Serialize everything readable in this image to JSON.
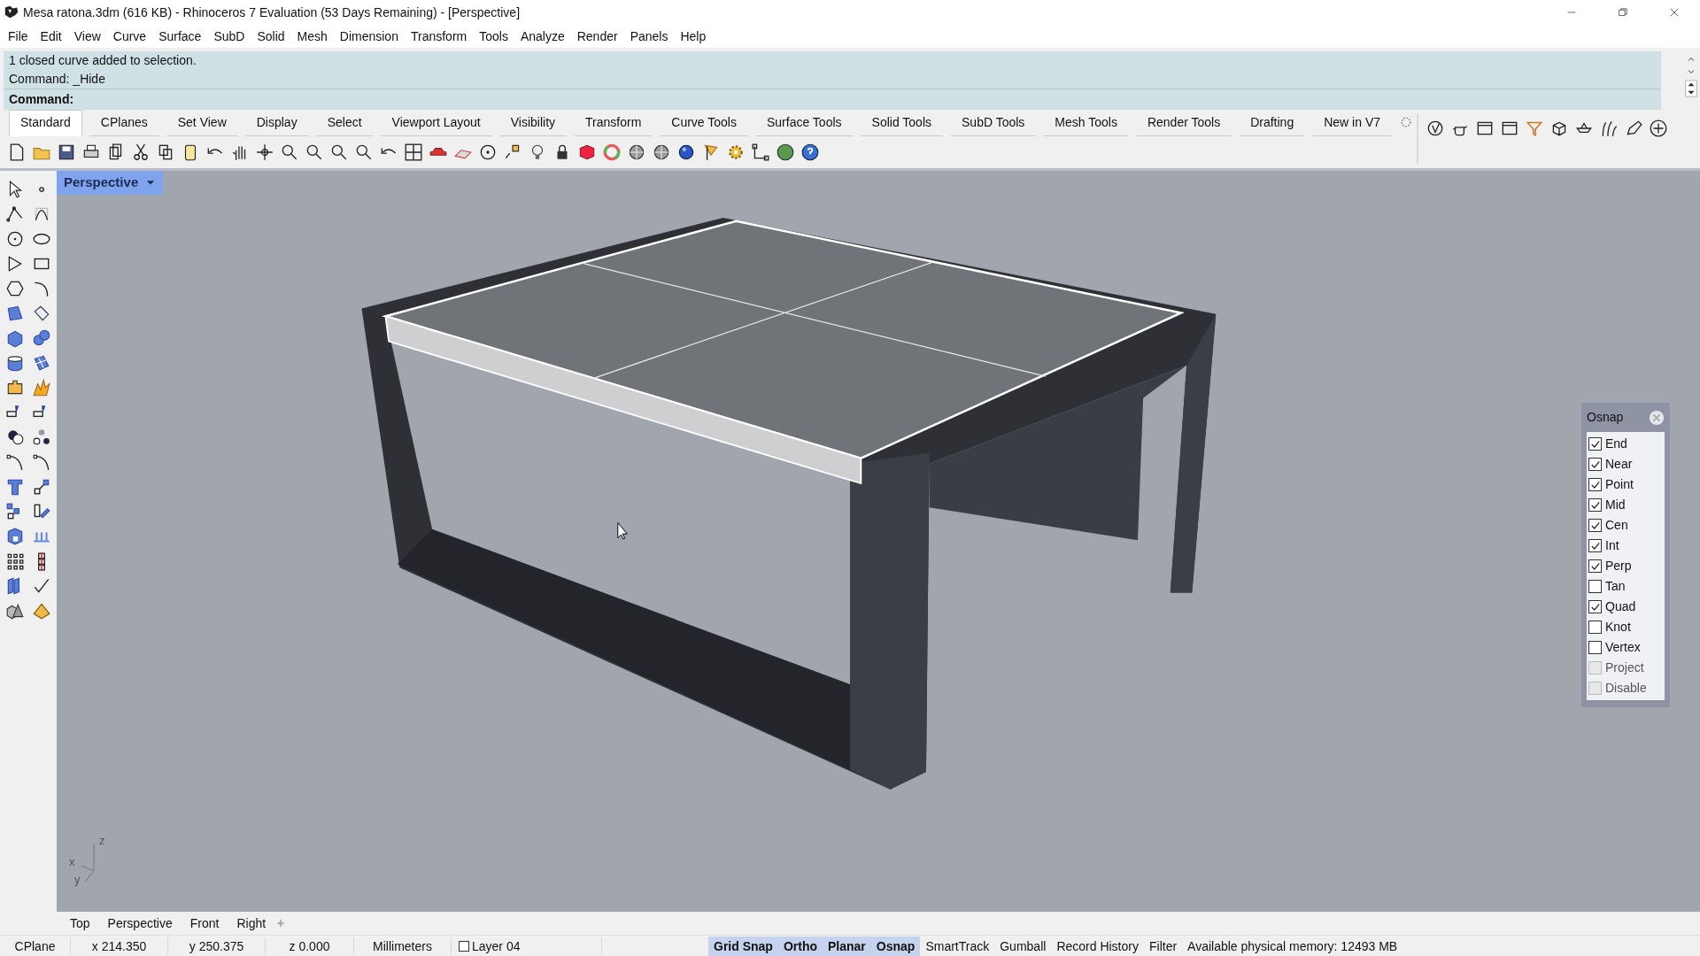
{
  "window": {
    "title": "Mesa ratona.3dm (616 KB) - Rhinoceros 7 Evaluation (53 Days Remaining) - [Perspective]"
  },
  "menu": [
    "File",
    "Edit",
    "View",
    "Curve",
    "Surface",
    "SubD",
    "Solid",
    "Mesh",
    "Dimension",
    "Transform",
    "Tools",
    "Analyze",
    "Render",
    "Panels",
    "Help"
  ],
  "command": {
    "history": [
      "1 closed curve added to selection.",
      "Command: _Hide"
    ],
    "prompt": "Command:"
  },
  "toolbar_tabs": [
    {
      "label": "Standard",
      "selected": true
    },
    {
      "label": "CPlanes",
      "selected": false
    },
    {
      "label": "Set View",
      "selected": false
    },
    {
      "label": "Display",
      "selected": false
    },
    {
      "label": "Select",
      "selected": false
    },
    {
      "label": "Viewport Layout",
      "selected": false
    },
    {
      "label": "Visibility",
      "selected": false
    },
    {
      "label": "Transform",
      "selected": false
    },
    {
      "label": "Curve Tools",
      "selected": false
    },
    {
      "label": "Surface Tools",
      "selected": false
    },
    {
      "label": "Solid Tools",
      "selected": false
    },
    {
      "label": "SubD Tools",
      "selected": false
    },
    {
      "label": "Mesh Tools",
      "selected": false
    },
    {
      "label": "Render Tools",
      "selected": false
    },
    {
      "label": "Drafting",
      "selected": false
    },
    {
      "label": "New in V7",
      "selected": false
    }
  ],
  "viewport": {
    "title": "Perspective",
    "axis_labels": [
      "z",
      "x",
      "y"
    ]
  },
  "osnap": {
    "title": "Osnap",
    "items": [
      {
        "label": "End",
        "checked": true,
        "disabled": false
      },
      {
        "label": "Near",
        "checked": true,
        "disabled": false
      },
      {
        "label": "Point",
        "checked": true,
        "disabled": false
      },
      {
        "label": "Mid",
        "checked": true,
        "disabled": false
      },
      {
        "label": "Cen",
        "checked": true,
        "disabled": false
      },
      {
        "label": "Int",
        "checked": true,
        "disabled": false
      },
      {
        "label": "Perp",
        "checked": true,
        "disabled": false
      },
      {
        "label": "Tan",
        "checked": false,
        "disabled": false
      },
      {
        "label": "Quad",
        "checked": true,
        "disabled": false
      },
      {
        "label": "Knot",
        "checked": false,
        "disabled": false
      },
      {
        "label": "Vertex",
        "checked": false,
        "disabled": false
      },
      {
        "label": "Project",
        "checked": false,
        "disabled": true
      },
      {
        "label": "Disable",
        "checked": false,
        "disabled": true
      }
    ]
  },
  "view_tabs": [
    "Top",
    "Perspective",
    "Front",
    "Right"
  ],
  "status_bar": {
    "cells": [
      {
        "kind": "text",
        "text": "CPlane"
      },
      {
        "kind": "text",
        "text": "x 214.350"
      },
      {
        "kind": "text",
        "text": "y 250.375"
      },
      {
        "kind": "text",
        "text": "z 0.000"
      },
      {
        "kind": "text",
        "text": "Millimeters"
      },
      {
        "kind": "layer",
        "text": "Layer 04"
      }
    ],
    "toggles": [
      {
        "label": "Grid Snap",
        "on": true
      },
      {
        "label": "Ortho",
        "on": true
      },
      {
        "label": "Planar",
        "on": true
      },
      {
        "label": "Osnap",
        "on": true
      },
      {
        "label": "SmartTrack",
        "on": false
      },
      {
        "label": "Gumball",
        "on": false
      },
      {
        "label": "Record History",
        "on": false
      },
      {
        "label": "Filter",
        "on": false
      }
    ],
    "memory": "Available physical memory: 12493 MB"
  }
}
